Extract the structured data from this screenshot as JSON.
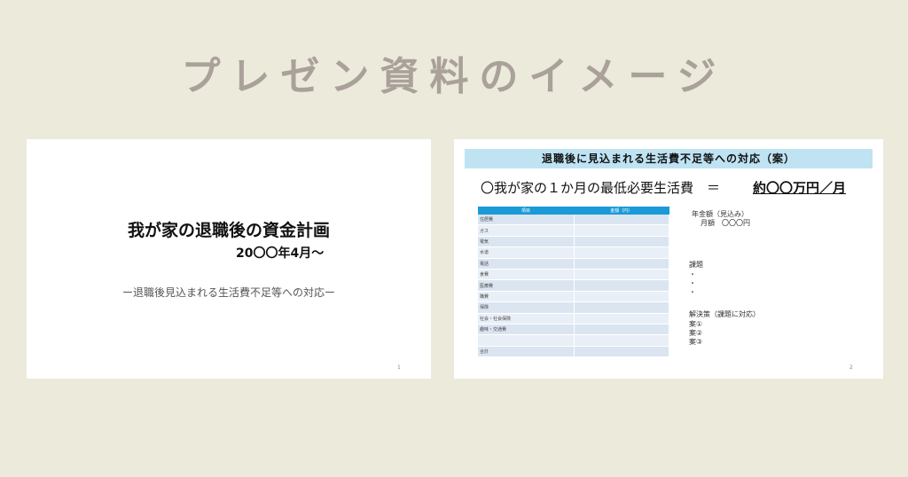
{
  "banner": {
    "title": "プレゼン資料のイメージ"
  },
  "slide1": {
    "title": "我が家の退職後の資金計画",
    "date": "20〇〇年4月～",
    "subtitle": "ー退職後見込まれる生活費不足等への対応ー",
    "page": "1"
  },
  "slide2": {
    "header": "退職後に見込まれる生活費不足等への対応（案）",
    "line": "〇我が家の１か月の最低必要生活費　＝",
    "amount": "約〇〇万円／月",
    "table": {
      "headers": [
        "項目",
        "金額（円）"
      ],
      "rows": [
        "住居費",
        "ガス",
        "電気",
        "水道",
        "電話",
        "食費",
        "医療費",
        "職費",
        "保険",
        "社会・社会保険",
        "趣味・交通費",
        "",
        "合計"
      ]
    },
    "annual": {
      "label": "年金額（見込み）",
      "monthly": "月額　〇〇〇円"
    },
    "issues": {
      "label": "課題",
      "bullets": [
        "・",
        "・",
        "・"
      ]
    },
    "solutions": {
      "label": "解決策（課題に対応）",
      "items": [
        "案①",
        "案②",
        "案③"
      ]
    },
    "page": "2"
  }
}
